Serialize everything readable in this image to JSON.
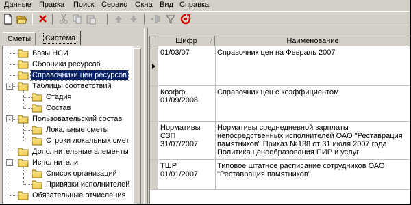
{
  "menu": [
    "Данные",
    "Правка",
    "Поиск",
    "Сервис",
    "Окна",
    "Вид",
    "Справка"
  ],
  "tabs": {
    "tab1": "Сметы",
    "tab2": "Система"
  },
  "tree": [
    {
      "label": "Базы НСИ",
      "level": 1
    },
    {
      "label": "Сборники ресурсов",
      "level": 1
    },
    {
      "label": "Справочники цен ресурсов",
      "level": 1,
      "selected": true
    },
    {
      "label": "Таблицы соответствий",
      "level": 1,
      "expander": "-"
    },
    {
      "label": "Стадия",
      "level": 2
    },
    {
      "label": "Состав",
      "level": 2
    },
    {
      "label": "Пользовательский состав",
      "level": 1,
      "expander": "-"
    },
    {
      "label": "Локальные сметы",
      "level": 2
    },
    {
      "label": "Строки локальных смет",
      "level": 2
    },
    {
      "label": "Дополнительные элементы",
      "level": 1
    },
    {
      "label": "Исполнители",
      "level": 1,
      "expander": "-"
    },
    {
      "label": "Список организаций",
      "level": 2
    },
    {
      "label": "Привязки исполнителей",
      "level": 2
    },
    {
      "label": "Обязательные отчисления",
      "level": 1
    }
  ],
  "grid": {
    "headers": {
      "code": "Шифр",
      "name": "Наименование"
    },
    "rows": [
      {
        "code": "01/03/07",
        "name": "Справочник цен на Февраль 2007",
        "current": true
      },
      {
        "code": "Коэфф.\n01/09/2008",
        "name": "Справочник цен с коэффициентом"
      },
      {
        "code": "Нормативы\nСЗП\n31/07/2007",
        "name": "Нормативы среднедневной зарплаты непосредственных исполнителей ОАО \"Реставрация памятников\" Приказ №138 от 31 июля 2007 года Политика ценообразования ПИР и услуг"
      },
      {
        "code": "ТШР\n01/01/2007",
        "name": "Типовое штатное расписание сотрудников ОАО \"Реставрация памятников\""
      }
    ]
  },
  "toolbar_icons": [
    "new-document-icon",
    "open-folder-icon",
    "delete-icon",
    "cut-icon",
    "copy-icon",
    "paste-icon",
    "move-up-icon",
    "move-down-icon",
    "insert-column-icon",
    "filter-icon",
    "refresh-icon"
  ]
}
